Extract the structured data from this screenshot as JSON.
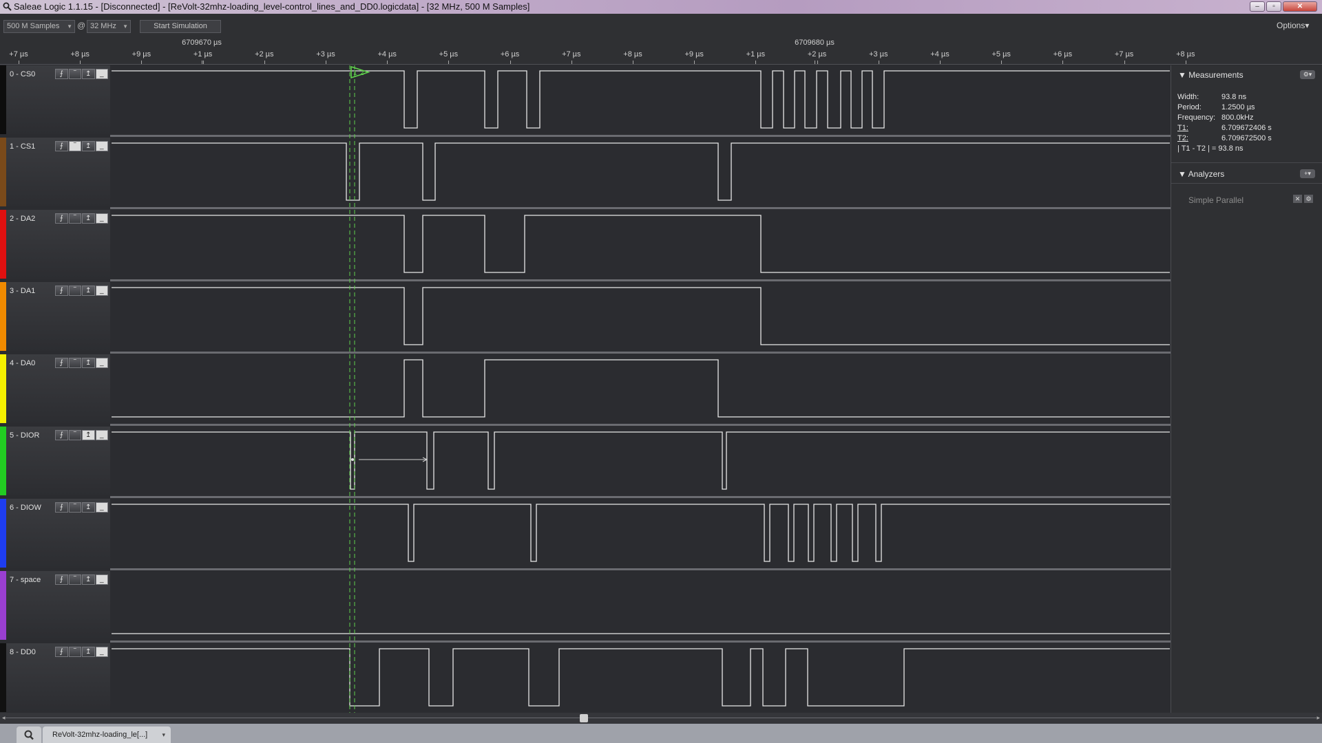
{
  "window": {
    "title": "Saleae Logic 1.1.15 - [Disconnected] - [ReVolt-32mhz-loading_level-control_lines_and_DD0.logicdata] - [32 MHz, 500 M Samples]",
    "min_glyph": "–",
    "max_glyph": "▫",
    "close_glyph": "✕"
  },
  "toolbar": {
    "samples_value": "500 M Samples",
    "at": "@",
    "rate_value": "32 MHz",
    "simulation_label": "Start Simulation",
    "options_label": "Options▾"
  },
  "ruler": {
    "abs_left": "6709670 µs",
    "abs_right": "6709680 µs",
    "ticks": [
      "+7 µs",
      "+8 µs",
      "+9 µs",
      "+1 µs",
      "+2 µs",
      "+3 µs",
      "+4 µs",
      "+5 µs",
      "+6 µs",
      "+7 µs",
      "+8 µs",
      "+9 µs",
      "+1 µs",
      "+2 µs",
      "+3 µs",
      "+4 µs",
      "+5 µs",
      "+6 µs",
      "+7 µs",
      "+8 µs"
    ]
  },
  "trigger_glyphs": [
    "⨍",
    "‾",
    "↥",
    "_"
  ],
  "channels": [
    {
      "label": "0 - CS0",
      "color": "#0d0d0d"
    },
    {
      "label": "1 - CS1",
      "color": "#7a4a1a"
    },
    {
      "label": "2 - DA2",
      "color": "#e01010"
    },
    {
      "label": "3 - DA1",
      "color": "#f08a00"
    },
    {
      "label": "4 - DA0",
      "color": "#f5f000"
    },
    {
      "label": "5 - DIOR",
      "color": "#22cc22"
    },
    {
      "label": "6 - DIOW",
      "color": "#1e3df0"
    },
    {
      "label": "7 - space",
      "color": "#9a3fd0"
    },
    {
      "label": "8 - DD0",
      "color": "#111111"
    }
  ],
  "colors": {
    "plot_bg": "#2b2c30",
    "signal": "#e8e8e8",
    "marker": "#5fd14b"
  },
  "marker_labels": {
    "t1": "1",
    "t2": "2"
  },
  "measurements": {
    "header": "Measurements",
    "rows": [
      {
        "label": "Width:",
        "value": "93.8 ns"
      },
      {
        "label": "Period:",
        "value": "1.2500 µs"
      },
      {
        "label": "Frequency:",
        "value": "800.0kHz"
      },
      {
        "label": "T1:",
        "value": "6.709672406 s"
      },
      {
        "label": "T2:",
        "value": "6.709672500 s"
      },
      {
        "label": "| T1 - T2 | = 93.8 ns",
        "value": ""
      }
    ]
  },
  "analyzers": {
    "header": "Analyzers",
    "add_label": "+▾",
    "gear_label": "⚙▾",
    "items": [
      {
        "label": "Simple Parallel",
        "remove_glyph": "✕",
        "settings_glyph": "⚙"
      }
    ]
  },
  "tabs": {
    "file_tab": "ReVolt-32mhz-loading_le[...]",
    "file_caret": "▾",
    "scroll_left": "◂",
    "scroll_right": "▸"
  }
}
